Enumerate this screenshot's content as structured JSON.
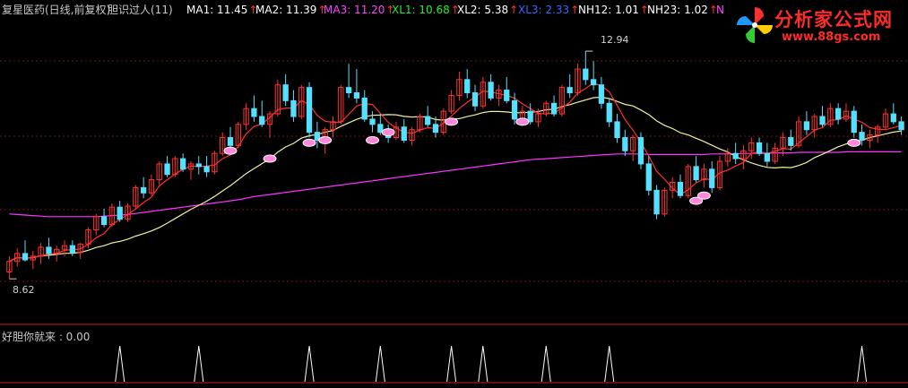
{
  "header": {
    "stock_name": "复星医药(日线,前复权)",
    "indicator_name": "胆识过人(11)",
    "metrics": [
      {
        "label": "MA1: 11.45",
        "color": "#ffffff",
        "arrow": "↑"
      },
      {
        "label": "MA2: 11.39",
        "color": "#ffffff",
        "arrow": "↑"
      },
      {
        "label": "MA3: 11.20",
        "color": "#ff44ff",
        "arrow": "↑"
      },
      {
        "label": "XL1: 10.68",
        "color": "#22ee22",
        "arrow": "↑"
      },
      {
        "label": "XL2: 5.38",
        "color": "#ffffff",
        "arrow": "↑"
      },
      {
        "label": "XL3: 2.33",
        "color": "#3366ff",
        "arrow": "↑"
      },
      {
        "label": "NH12: 1.01",
        "color": "#ffffff",
        "arrow": "↑"
      },
      {
        "label": "NH23: 1.02",
        "color": "#ffffff",
        "arrow": "↑"
      },
      {
        "label": "N",
        "color": "#ff44ff",
        "arrow": ""
      }
    ],
    "arrow_color": "#ff3333",
    "label_color": "#c8c8c8"
  },
  "logo": {
    "text": "分析家公式网",
    "url": "www.88gs.com"
  },
  "sub_panel": {
    "title": "好胆你就来 : 0.00"
  },
  "chart_data": {
    "type": "candlestick",
    "price_range": [
      8.3,
      13.4
    ],
    "high_label": "12.94",
    "low_label": "8.62",
    "ohlc": [
      [
        8.75,
        9.05,
        8.62,
        8.95
      ],
      [
        8.95,
        9.2,
        8.85,
        9.1
      ],
      [
        9.1,
        9.35,
        8.95,
        8.98
      ],
      [
        8.98,
        9.15,
        8.8,
        9.05
      ],
      [
        9.05,
        9.3,
        8.9,
        9.22
      ],
      [
        9.22,
        9.4,
        9.0,
        9.1
      ],
      [
        9.1,
        9.25,
        8.95,
        9.18
      ],
      [
        9.18,
        9.35,
        9.05,
        9.25
      ],
      [
        9.25,
        9.35,
        9.05,
        9.12
      ],
      [
        9.12,
        9.3,
        9.0,
        9.28
      ],
      [
        9.28,
        9.6,
        9.2,
        9.55
      ],
      [
        9.55,
        9.85,
        9.45,
        9.8
      ],
      [
        9.8,
        9.95,
        9.6,
        9.65
      ],
      [
        9.65,
        10.05,
        9.6,
        9.98
      ],
      [
        9.98,
        10.1,
        9.7,
        9.75
      ],
      [
        9.75,
        10.05,
        9.7,
        10.0
      ],
      [
        10.0,
        10.4,
        9.95,
        10.35
      ],
      [
        10.35,
        10.55,
        10.15,
        10.25
      ],
      [
        10.25,
        10.6,
        10.2,
        10.5
      ],
      [
        10.5,
        10.85,
        10.4,
        10.8
      ],
      [
        10.8,
        10.95,
        10.55,
        10.6
      ],
      [
        10.6,
        10.95,
        10.55,
        10.9
      ],
      [
        10.9,
        11.0,
        10.65,
        10.7
      ],
      [
        10.7,
        10.85,
        10.5,
        10.8
      ],
      [
        10.8,
        10.95,
        10.6,
        10.75
      ],
      [
        10.75,
        10.95,
        10.55,
        10.65
      ],
      [
        10.65,
        11.05,
        10.6,
        11.0
      ],
      [
        11.0,
        11.4,
        10.95,
        11.3
      ],
      [
        11.3,
        11.5,
        11.05,
        11.15
      ],
      [
        11.15,
        11.6,
        11.1,
        11.55
      ],
      [
        11.55,
        11.95,
        11.45,
        11.85
      ],
      [
        11.85,
        12.1,
        11.6,
        11.7
      ],
      [
        11.7,
        12.0,
        11.5,
        11.55
      ],
      [
        11.55,
        11.8,
        11.3,
        11.75
      ],
      [
        11.75,
        12.4,
        11.7,
        12.3
      ],
      [
        12.3,
        12.5,
        11.9,
        12.0
      ],
      [
        12.0,
        12.2,
        11.6,
        11.7
      ],
      [
        11.7,
        12.3,
        11.65,
        12.25
      ],
      [
        12.25,
        12.35,
        11.3,
        11.4
      ],
      [
        11.4,
        11.6,
        11.1,
        11.25
      ],
      [
        11.25,
        11.5,
        11.0,
        11.45
      ],
      [
        11.45,
        11.7,
        11.3,
        11.6
      ],
      [
        11.6,
        12.3,
        11.55,
        12.25
      ],
      [
        12.25,
        12.7,
        12.05,
        12.15
      ],
      [
        12.15,
        12.6,
        11.95,
        12.05
      ],
      [
        12.05,
        12.2,
        11.6,
        11.65
      ],
      [
        11.65,
        11.8,
        11.4,
        11.55
      ],
      [
        11.55,
        11.75,
        11.35,
        11.4
      ],
      [
        11.4,
        11.55,
        11.2,
        11.3
      ],
      [
        11.3,
        11.6,
        11.25,
        11.5
      ],
      [
        11.5,
        11.65,
        11.2,
        11.25
      ],
      [
        11.25,
        11.5,
        11.15,
        11.45
      ],
      [
        11.45,
        11.75,
        11.4,
        11.7
      ],
      [
        11.7,
        11.9,
        11.5,
        11.55
      ],
      [
        11.55,
        11.7,
        11.3,
        11.4
      ],
      [
        11.4,
        11.85,
        11.35,
        11.8
      ],
      [
        11.8,
        12.2,
        11.75,
        12.1
      ],
      [
        12.1,
        12.55,
        12.0,
        12.4
      ],
      [
        12.4,
        12.6,
        12.05,
        12.15
      ],
      [
        12.15,
        12.3,
        11.8,
        11.9
      ],
      [
        11.9,
        12.45,
        11.85,
        12.35
      ],
      [
        12.35,
        12.5,
        12.0,
        12.05
      ],
      [
        12.05,
        12.3,
        11.9,
        12.2
      ],
      [
        12.2,
        12.45,
        11.95,
        12.0
      ],
      [
        12.0,
        12.15,
        11.55,
        11.65
      ],
      [
        11.65,
        11.9,
        11.55,
        11.8
      ],
      [
        11.8,
        11.95,
        11.55,
        11.6
      ],
      [
        11.6,
        11.85,
        11.5,
        11.75
      ],
      [
        11.75,
        12.0,
        11.7,
        11.95
      ],
      [
        11.95,
        12.1,
        11.7,
        11.75
      ],
      [
        11.75,
        12.3,
        11.7,
        12.25
      ],
      [
        12.25,
        12.5,
        12.05,
        12.15
      ],
      [
        12.15,
        12.7,
        12.1,
        12.6
      ],
      [
        12.6,
        12.94,
        12.3,
        12.4
      ],
      [
        12.4,
        12.75,
        12.2,
        12.3
      ],
      [
        12.3,
        12.45,
        11.85,
        11.95
      ],
      [
        11.95,
        12.05,
        11.5,
        11.6
      ],
      [
        11.6,
        11.75,
        11.2,
        11.3
      ],
      [
        11.3,
        11.45,
        10.95,
        11.05
      ],
      [
        11.05,
        11.35,
        10.85,
        11.3
      ],
      [
        11.3,
        11.4,
        10.7,
        10.8
      ],
      [
        10.8,
        10.95,
        10.2,
        10.3
      ],
      [
        10.3,
        10.4,
        9.75,
        9.85
      ],
      [
        9.85,
        10.35,
        9.8,
        10.3
      ],
      [
        10.3,
        10.55,
        10.15,
        10.45
      ],
      [
        10.45,
        10.6,
        10.15,
        10.2
      ],
      [
        10.2,
        10.8,
        10.15,
        10.75
      ],
      [
        10.75,
        10.95,
        10.45,
        10.5
      ],
      [
        10.5,
        10.8,
        10.35,
        10.7
      ],
      [
        10.7,
        10.85,
        10.25,
        10.35
      ],
      [
        10.35,
        10.95,
        10.3,
        10.85
      ],
      [
        10.85,
        11.1,
        10.75,
        11.0
      ],
      [
        11.0,
        11.2,
        10.8,
        10.9
      ],
      [
        10.9,
        11.15,
        10.7,
        11.05
      ],
      [
        11.05,
        11.3,
        10.9,
        11.2
      ],
      [
        11.2,
        11.3,
        10.95,
        11.0
      ],
      [
        11.0,
        11.2,
        10.75,
        10.85
      ],
      [
        10.85,
        11.2,
        10.8,
        11.1
      ],
      [
        11.1,
        11.4,
        10.95,
        11.3
      ],
      [
        11.3,
        11.45,
        11.05,
        11.15
      ],
      [
        11.15,
        11.7,
        11.1,
        11.6
      ],
      [
        11.6,
        11.8,
        11.35,
        11.45
      ],
      [
        11.45,
        11.75,
        11.3,
        11.7
      ],
      [
        11.7,
        11.9,
        11.5,
        11.55
      ],
      [
        11.55,
        11.95,
        11.5,
        11.85
      ],
      [
        11.85,
        11.95,
        11.55,
        11.65
      ],
      [
        11.65,
        11.95,
        11.6,
        11.8
      ],
      [
        11.8,
        11.9,
        11.3,
        11.4
      ],
      [
        11.4,
        11.55,
        11.15,
        11.25
      ],
      [
        11.25,
        11.45,
        11.1,
        11.35
      ],
      [
        11.35,
        11.55,
        11.2,
        11.5
      ],
      [
        11.5,
        11.85,
        11.45,
        11.75
      ],
      [
        11.75,
        11.95,
        11.55,
        11.6
      ],
      [
        11.6,
        11.7,
        11.35,
        11.45
      ]
    ],
    "ma_long": [
      9.85,
      9.84,
      9.83,
      9.82,
      9.81,
      9.8,
      9.8,
      9.8,
      9.8,
      9.8,
      9.8,
      9.8,
      9.81,
      9.82,
      9.83,
      9.84,
      9.86,
      9.88,
      9.9,
      9.92,
      9.94,
      9.96,
      9.98,
      10.0,
      10.02,
      10.04,
      10.06,
      10.08,
      10.1,
      10.12,
      10.15,
      10.18,
      10.2,
      10.22,
      10.24,
      10.26,
      10.28,
      10.3,
      10.32,
      10.34,
      10.36,
      10.38,
      10.4,
      10.42,
      10.44,
      10.46,
      10.48,
      10.5,
      10.52,
      10.54,
      10.56,
      10.58,
      10.6,
      10.62,
      10.64,
      10.66,
      10.68,
      10.7,
      10.72,
      10.74,
      10.76,
      10.78,
      10.8,
      10.82,
      10.84,
      10.86,
      10.88,
      10.89,
      10.9,
      10.91,
      10.92,
      10.93,
      10.94,
      10.95,
      10.96,
      10.97,
      10.98,
      10.99,
      10.99,
      10.99,
      10.99,
      10.98,
      10.98,
      10.98,
      10.98,
      10.98,
      10.98,
      10.98,
      10.98,
      10.99,
      10.99,
      10.99,
      10.99,
      11.0,
      11.0,
      11.0,
      11.0,
      11.01,
      11.01,
      11.01,
      11.02,
      11.02,
      11.02,
      11.02,
      11.02,
      11.02,
      11.03,
      11.03,
      11.03,
      11.03,
      11.03,
      11.03,
      11.03,
      11.03
    ],
    "signals": [
      {
        "index": 28,
        "value": 11.05,
        "type": "pink"
      },
      {
        "index": 33,
        "value": 10.9,
        "type": "pink"
      },
      {
        "index": 38,
        "value": 11.2,
        "type": "pink"
      },
      {
        "index": 40,
        "value": 11.25,
        "type": "pink"
      },
      {
        "index": 46,
        "value": 11.25,
        "type": "pink"
      },
      {
        "index": 48,
        "value": 11.4,
        "type": "pink"
      },
      {
        "index": 56,
        "value": 11.6,
        "type": "pink"
      },
      {
        "index": 65,
        "value": 11.6,
        "type": "pink"
      },
      {
        "index": 87,
        "value": 10.1,
        "type": "pink"
      },
      {
        "index": 88,
        "value": 10.2,
        "type": "pink"
      },
      {
        "index": 107,
        "value": 11.2,
        "type": "pink"
      }
    ],
    "bottom_signals": [
      {
        "index": 14
      },
      {
        "index": 24
      },
      {
        "index": 38
      },
      {
        "index": 47
      },
      {
        "index": 56
      },
      {
        "index": 60
      },
      {
        "index": 68
      },
      {
        "index": 76
      },
      {
        "index": 108
      }
    ]
  }
}
